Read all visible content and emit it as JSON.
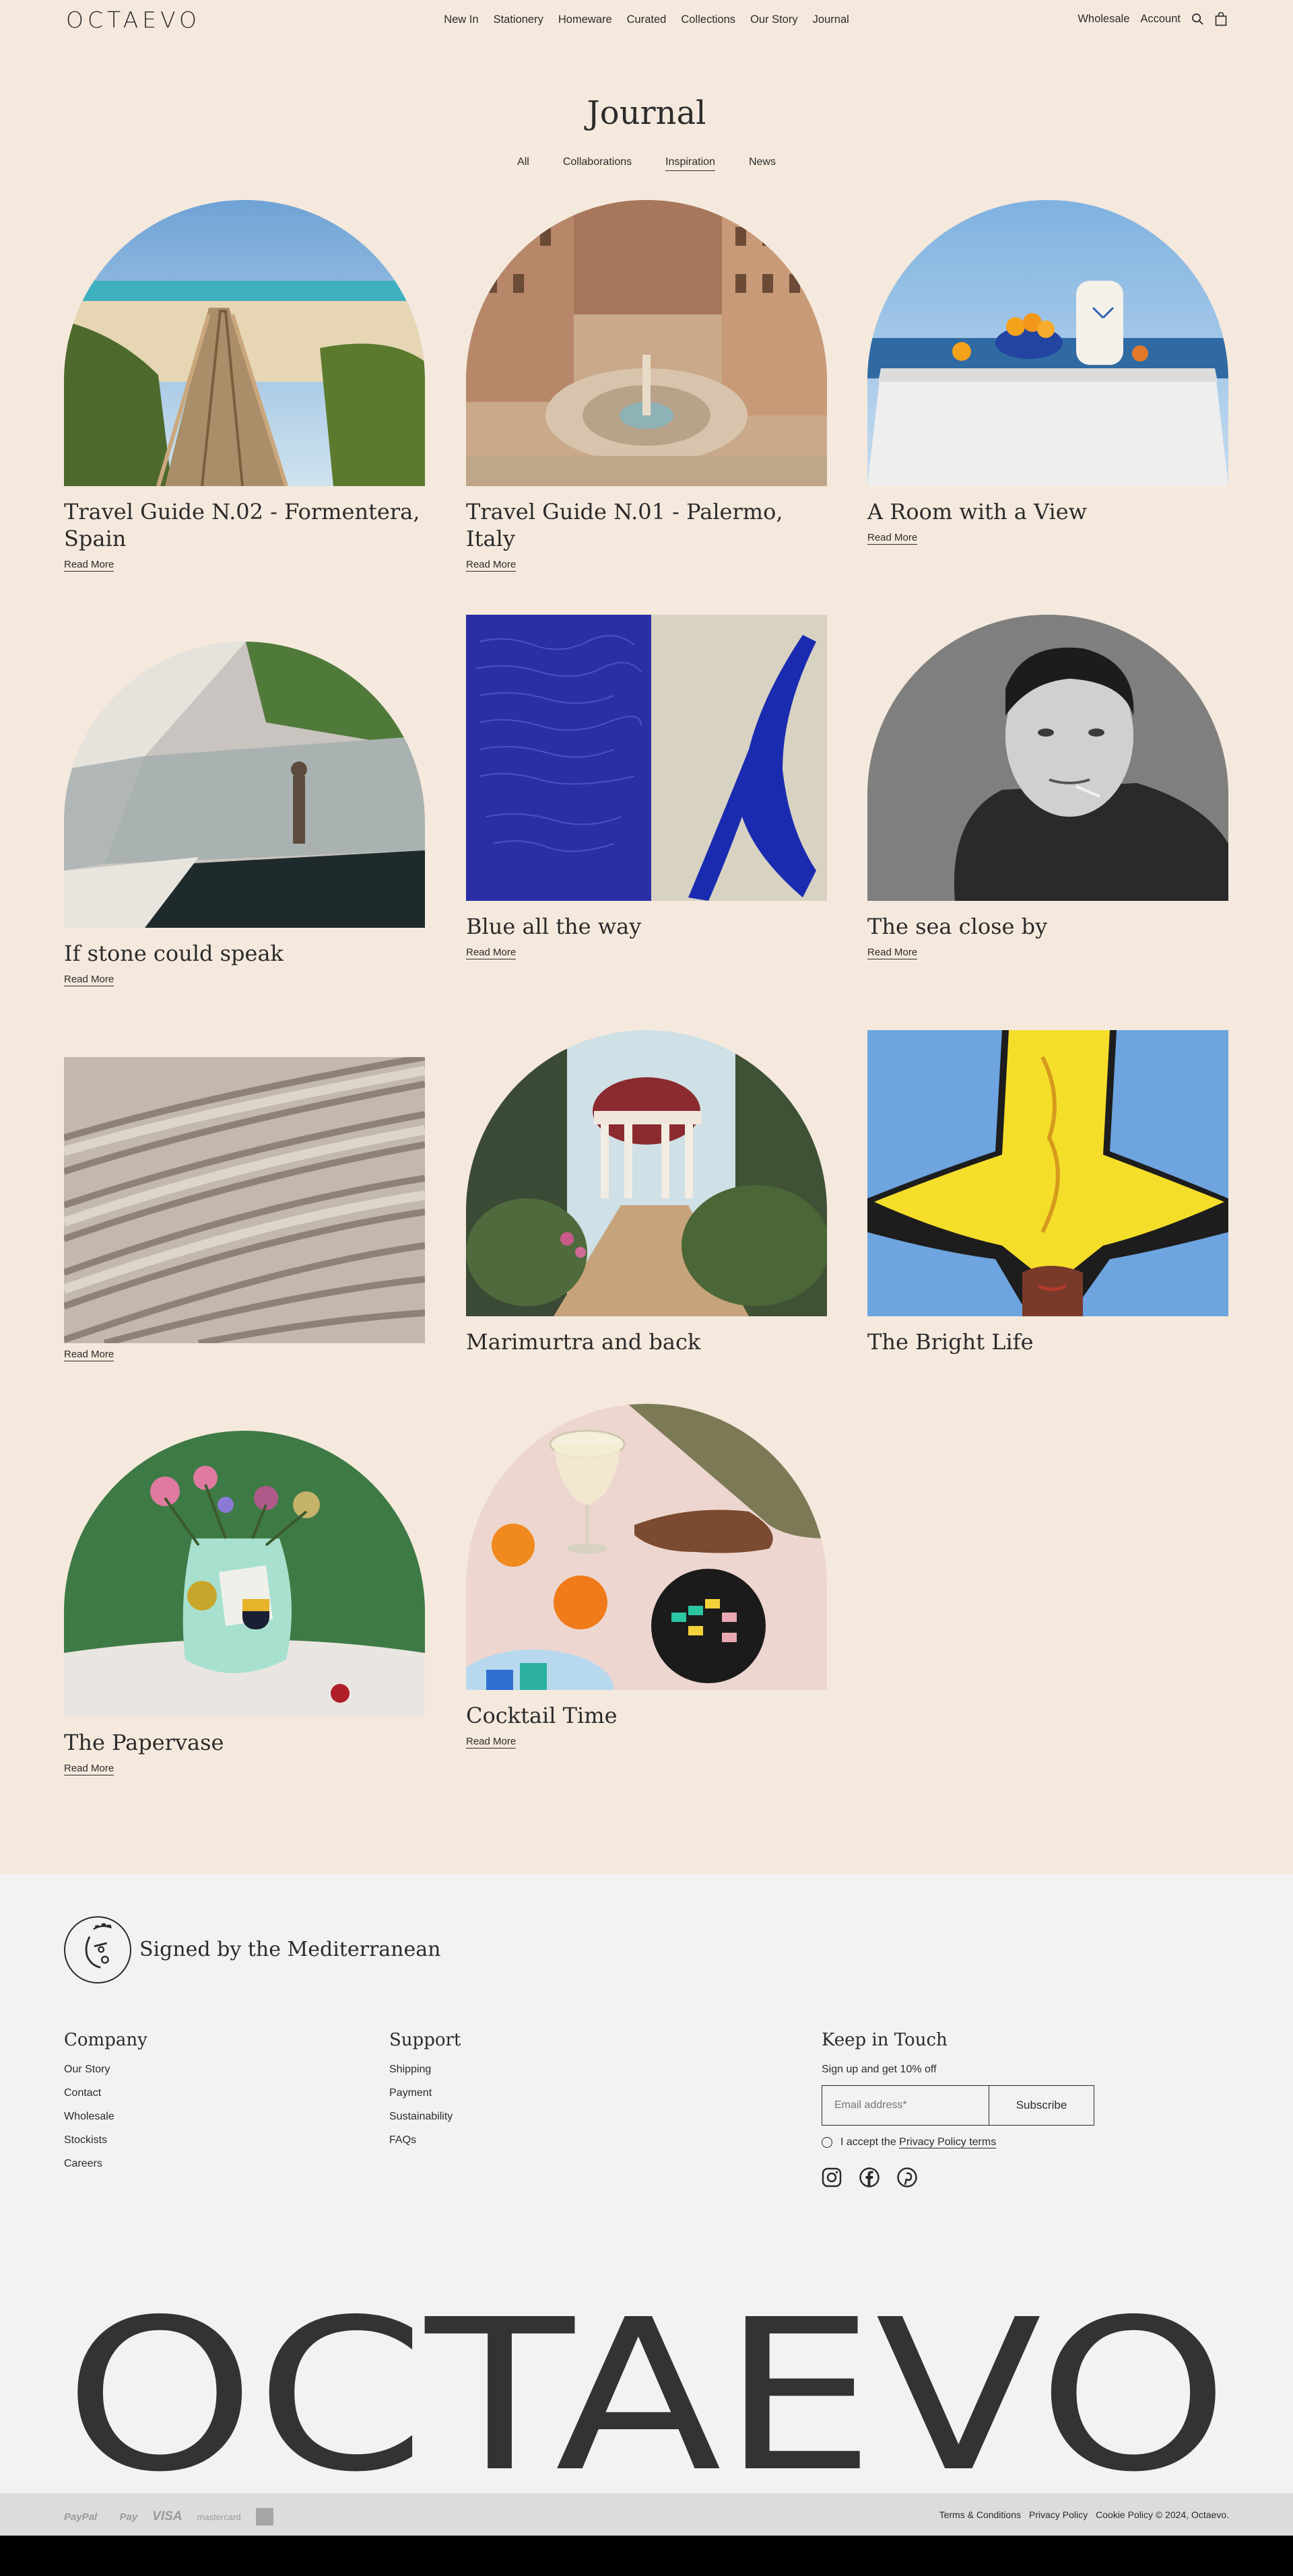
{
  "brand": {
    "logo": "OCTAEVO"
  },
  "nav": {
    "items": [
      "New In",
      "Stationery",
      "Homeware",
      "Curated",
      "Collections",
      "Our Story",
      "Journal"
    ],
    "wholesale": "Wholesale",
    "account": "Account"
  },
  "page": {
    "title": "Journal",
    "filters": [
      "All",
      "Collaborations",
      "Inspiration",
      "News"
    ],
    "active_filter": "Inspiration"
  },
  "articles": [
    {
      "title": "Travel Guide N.02 - Formentera, Spain",
      "link": "Read More"
    },
    {
      "title": "Travel Guide N.01 - Palermo, Italy",
      "link": "Read More"
    },
    {
      "title": "A Room with a View",
      "link": "Read More"
    },
    {
      "title": "If stone could speak",
      "link": "Read More"
    },
    {
      "title": "Blue all the way",
      "link": "Read More"
    },
    {
      "title": "The sea close by",
      "link": "Read More"
    },
    {
      "title": "",
      "link": "Read More"
    },
    {
      "title": "Marimurtra and back",
      "link": ""
    },
    {
      "title": "The Bright Life",
      "link": ""
    },
    {
      "title": "The Papervase",
      "link": "Read More"
    },
    {
      "title": "Cocktail Time",
      "link": "Read More"
    }
  ],
  "footer": {
    "tagline": "Signed by the Mediterranean",
    "company": {
      "heading": "Company",
      "links": [
        "Our Story",
        "Contact",
        "Wholesale",
        "Stockists",
        "Careers"
      ]
    },
    "support": {
      "heading": "Support",
      "links": [
        "Shipping",
        "Payment",
        "Sustainability",
        "FAQs"
      ]
    },
    "newsletter": {
      "heading": "Keep in Touch",
      "lead": "Sign up and get 10% off",
      "placeholder": "Email address*",
      "button": "Subscribe",
      "consent_prefix": "I accept the",
      "consent_link": "Privacy Policy terms"
    },
    "socials": [
      "instagram-icon",
      "facebook-icon",
      "pinterest-icon"
    ],
    "big_logo": "OCTAEVO",
    "payments": [
      "PayPal",
      "Pay",
      "VISA",
      "mastercard"
    ],
    "legal": [
      "Terms & Conditions",
      "Privacy Policy",
      "Cookie Policy © 2024, Octaevo."
    ]
  }
}
